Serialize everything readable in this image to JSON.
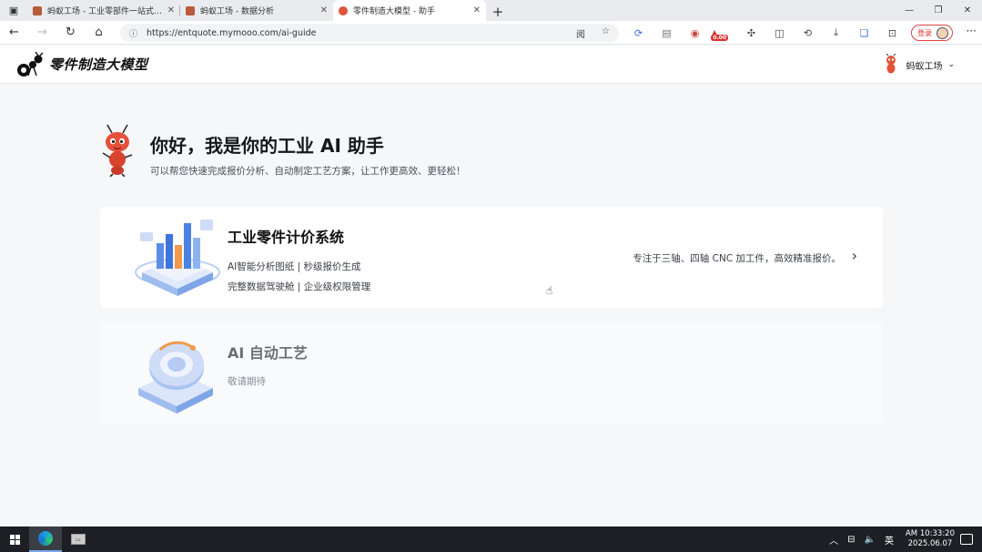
{
  "browser": {
    "tabs": [
      {
        "title": "蚂蚁工场 - 工业零部件一站式采购",
        "active": false
      },
      {
        "title": "蚂蚁工场 - 数据分析",
        "active": false
      },
      {
        "title": "零件制造大模型 - 助手",
        "active": true
      }
    ],
    "url": "https://entquote.mymooo.com/ai-guide",
    "reader_label": "阅",
    "profile_label": "登录",
    "ext_badge": "0.00"
  },
  "header": {
    "brand_name": "零件制造大模型",
    "user_name": "蚂蚁工场"
  },
  "hero": {
    "title": "你好，我是你的工业 AI 助手",
    "subtitle": "可以帮您快速完成报价分析、自动制定工艺方案，让工作更高效、更轻松！"
  },
  "cards": [
    {
      "title": "工业零件计价系统",
      "line1": "AI智能分析图纸 | 秒级报价生成",
      "line2": "完整数据驾驶舱 | 企业级权限管理",
      "description": "专注于三轴、四轴 CNC 加工件，高效精准报价。"
    },
    {
      "title": "AI 自动工艺",
      "line1": "敬请期待"
    }
  ],
  "taskbar": {
    "ime": "英",
    "time": "AM 10:33:20",
    "date": "2025.06.07"
  }
}
